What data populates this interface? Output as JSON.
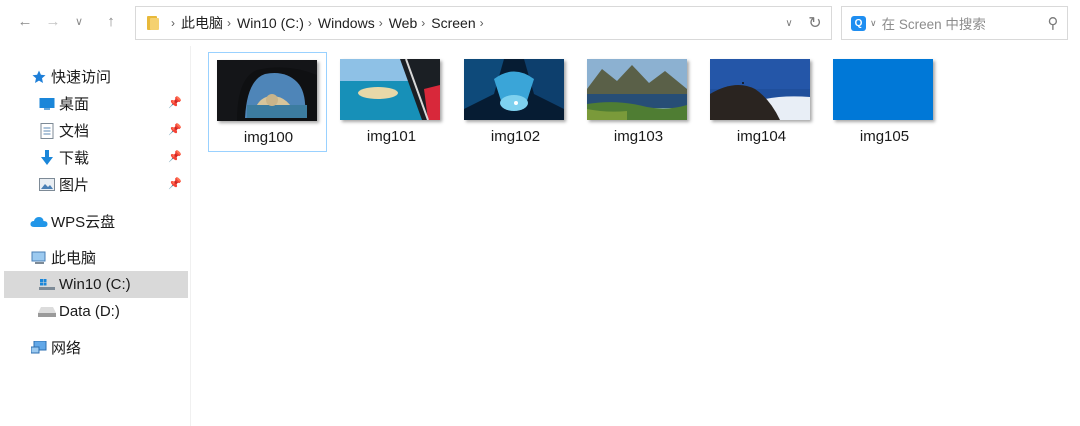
{
  "nav": {
    "back_icon": "arrow-left-icon",
    "forward_icon": "arrow-right-icon",
    "recent_icon": "chevron-down-icon",
    "up_icon": "arrow-up-icon"
  },
  "address": {
    "crumbs": [
      "此电脑",
      "Win10 (C:)",
      "Windows",
      "Web",
      "Screen"
    ],
    "separator": "›"
  },
  "search": {
    "placeholder": "在 Screen 中搜索",
    "engine_icon": "Q"
  },
  "sidebar": {
    "quick_access": "快速访问",
    "desktop": "桌面",
    "documents": "文档",
    "downloads": "下载",
    "pictures": "图片",
    "wps_cloud": "WPS云盘",
    "this_pc": "此电脑",
    "drive_c": "Win10 (C:)",
    "drive_d": "Data (D:)",
    "network": "网络"
  },
  "files": [
    {
      "name": "img100"
    },
    {
      "name": "img101"
    },
    {
      "name": "img102"
    },
    {
      "name": "img103"
    },
    {
      "name": "img104"
    },
    {
      "name": "img105"
    }
  ],
  "colors": {
    "selection": "#d9d9d9",
    "tile_selection_border": "#99d1ff",
    "accent": "#0078d7"
  }
}
